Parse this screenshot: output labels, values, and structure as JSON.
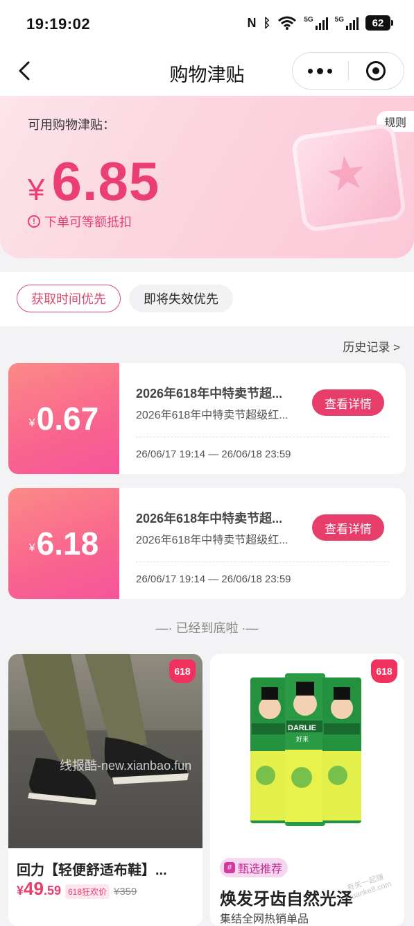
{
  "status_bar": {
    "time": "19:19:02",
    "battery": "62",
    "signal_label": "5G"
  },
  "nav": {
    "title": "购物津贴"
  },
  "hero": {
    "label": "可用购物津贴：",
    "currency": "¥",
    "amount": "6.85",
    "note": "下单可等额抵扣",
    "rules": "规则"
  },
  "sort_tabs": [
    {
      "label": "获取时间优先",
      "active": true
    },
    {
      "label": "即将失效优先",
      "active": false
    }
  ],
  "history_link": "历史记录 >",
  "coupons": [
    {
      "currency": "¥",
      "value": "0.67",
      "title": "2026年618年中特卖节超...",
      "desc": "2026年618年中特卖节超级红...",
      "button": "查看详情",
      "validity": "26/06/17 19:14 — 26/06/18 23:59"
    },
    {
      "currency": "¥",
      "value": "6.18",
      "title": "2026年618年中特卖节超...",
      "desc": "2026年618年中特卖节超级红...",
      "button": "查看详情",
      "validity": "26/06/17 19:14 — 26/06/18 23:59"
    }
  ],
  "end_text": "—·  已经到底啦  ·—",
  "products": [
    {
      "badge": "618",
      "name": "回力【轻便舒适布鞋】...",
      "currency": "¥",
      "price_int": "49",
      "price_dec": ".59",
      "tag": "618狂欢价",
      "orig_price": "¥359"
    },
    {
      "badge": "618",
      "rec_tag": "甄选推荐",
      "title": "焕发牙齿自然光泽",
      "subtitle": "集结全网热销单品",
      "brand": "DARLIE",
      "brand_cn": "好来"
    }
  ],
  "watermark": "线报酷-new.xianbao.fun",
  "watermark2": "有关一起赚 iuanke8.com"
}
